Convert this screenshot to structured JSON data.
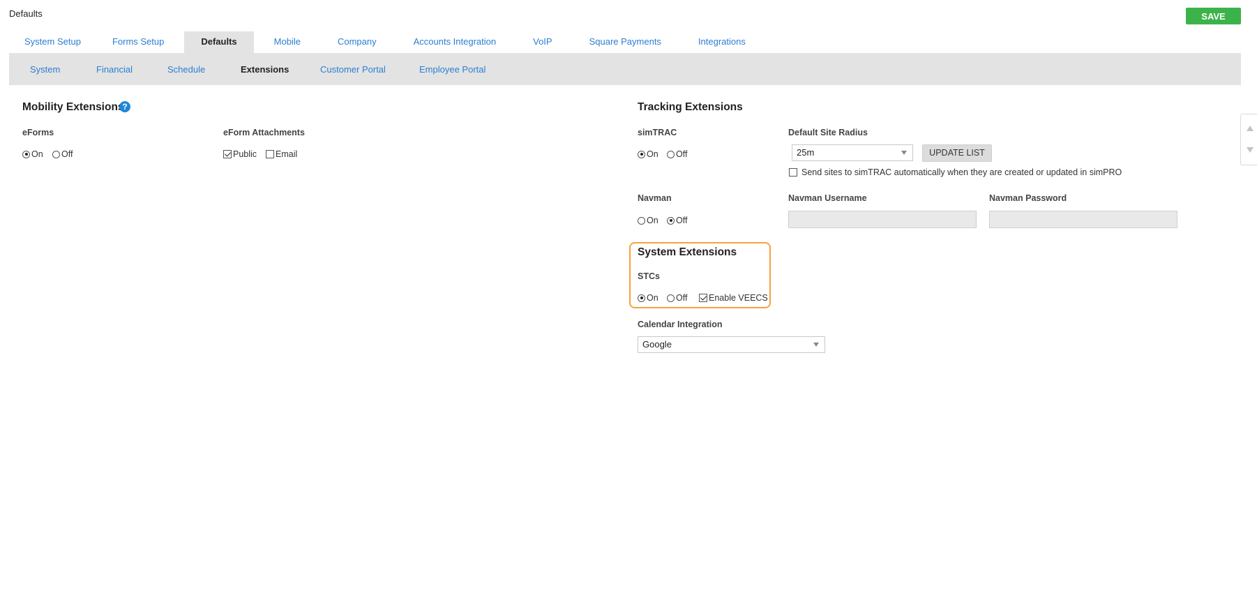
{
  "page": {
    "title": "Defaults",
    "save_label": "SAVE"
  },
  "main_tabs": [
    {
      "label": "System Setup"
    },
    {
      "label": "Forms Setup"
    },
    {
      "label": "Defaults"
    },
    {
      "label": "Mobile"
    },
    {
      "label": "Company"
    },
    {
      "label": "Accounts Integration"
    },
    {
      "label": "VoIP"
    },
    {
      "label": "Square Payments"
    },
    {
      "label": "Integrations"
    }
  ],
  "main_tabs_active": "Defaults",
  "sub_tabs": [
    {
      "label": "System"
    },
    {
      "label": "Financial"
    },
    {
      "label": "Schedule"
    },
    {
      "label": "Extensions"
    },
    {
      "label": "Customer Portal"
    },
    {
      "label": "Employee Portal"
    }
  ],
  "sub_tabs_active": "Extensions",
  "mobility": {
    "title": "Mobility Extensions",
    "help_icon": "?",
    "eforms": {
      "label": "eForms",
      "on": "On",
      "off": "Off",
      "selected": "On"
    },
    "attachments": {
      "label": "eForm Attachments",
      "public": "Public",
      "email": "Email",
      "public_checked": true,
      "email_checked": false
    }
  },
  "tracking": {
    "title": "Tracking Extensions",
    "simtrac": {
      "label": "simTRAC",
      "on": "On",
      "off": "Off",
      "selected": "On"
    },
    "radius": {
      "label": "Default Site Radius",
      "value": "25m",
      "update_button": "UPDATE LIST"
    },
    "send_sites": {
      "label": "Send sites to simTRAC automatically when they are created or updated in simPRO",
      "checked": false
    },
    "navman": {
      "label": "Navman",
      "on": "On",
      "off": "Off",
      "selected": "Off"
    },
    "navman_username": {
      "label": "Navman Username",
      "value": ""
    },
    "navman_password": {
      "label": "Navman Password",
      "value": ""
    }
  },
  "system_ext": {
    "title": "System Extensions",
    "stcs": {
      "label": "STCs",
      "on": "On",
      "off": "Off",
      "selected": "On"
    },
    "veecs": {
      "label": "Enable VEECS",
      "checked": true
    }
  },
  "calendar": {
    "label": "Calendar Integration",
    "value": "Google"
  },
  "colors": {
    "accent": "#2a7fd1",
    "save": "#3cb34a",
    "highlight": "#f5a23c",
    "help": "#1f87d6"
  }
}
